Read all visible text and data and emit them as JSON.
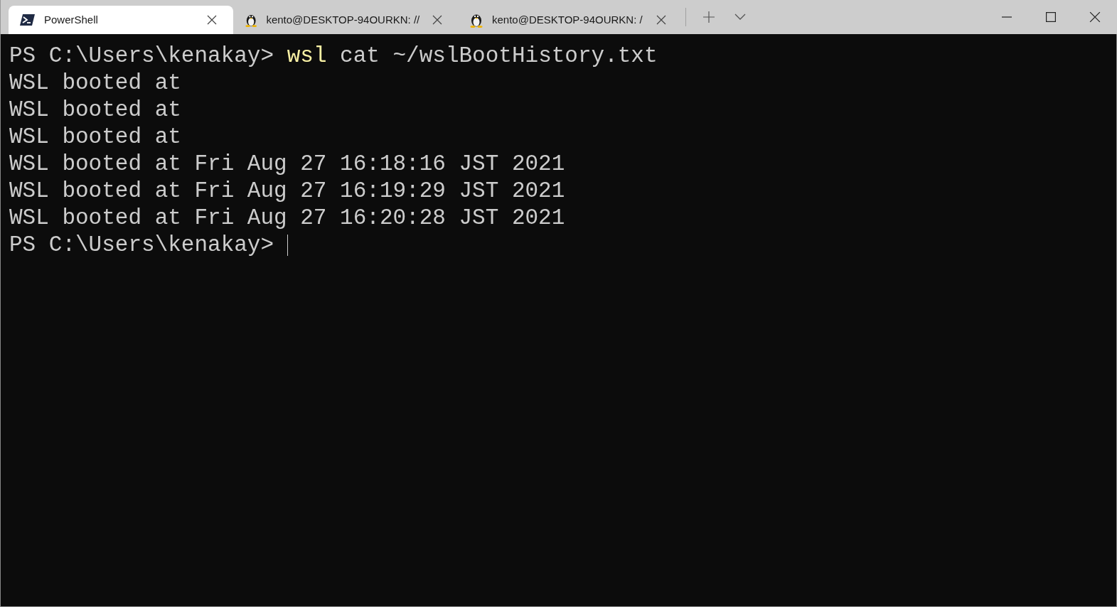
{
  "tabs": [
    {
      "kind": "powershell",
      "title": "PowerShell",
      "selected": true
    },
    {
      "kind": "linux",
      "title": "kento@DESKTOP-94OURKN: //",
      "selected": false
    },
    {
      "kind": "linux",
      "title": "kento@DESKTOP-94OURKN: /",
      "selected": false
    }
  ],
  "terminal": {
    "lines": [
      {
        "kind": "command",
        "prompt": "PS C:\\Users\\kenakay>",
        "command": "wsl",
        "args": "cat ~/wslBootHistory.txt"
      },
      {
        "kind": "output",
        "text": "WSL booted at"
      },
      {
        "kind": "output",
        "text": "WSL booted at"
      },
      {
        "kind": "output",
        "text": "WSL booted at"
      },
      {
        "kind": "output",
        "text": "WSL booted at Fri Aug 27 16:18:16 JST 2021"
      },
      {
        "kind": "output",
        "text": "WSL booted at Fri Aug 27 16:19:29 JST 2021"
      },
      {
        "kind": "output",
        "text": "WSL booted at Fri Aug 27 16:20:28 JST 2021"
      },
      {
        "kind": "prompt",
        "prompt": "PS C:\\Users\\kenakay>"
      }
    ]
  }
}
